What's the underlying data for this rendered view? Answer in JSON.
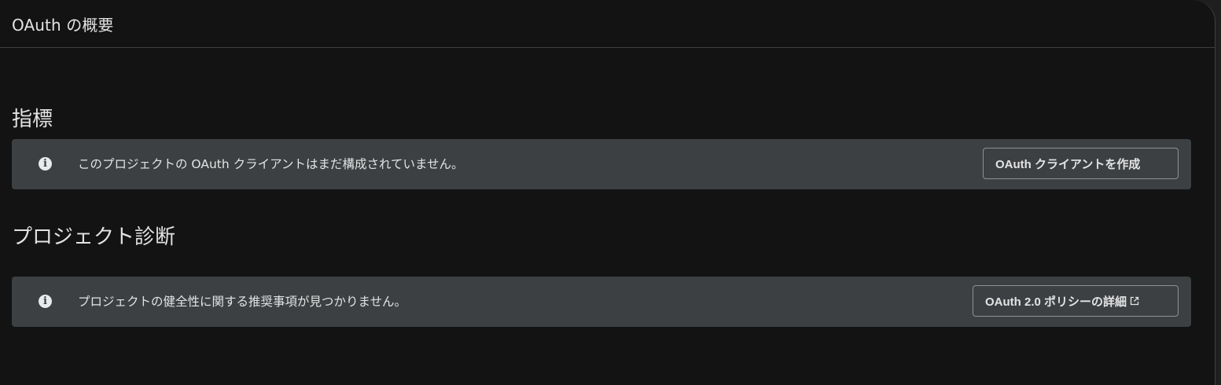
{
  "header": {
    "title": "OAuth の概要"
  },
  "metrics": {
    "title": "指標",
    "banner": {
      "icon": "info-icon",
      "message": "このプロジェクトの OAuth クライアントはまだ構成されていません。",
      "button_label": "OAuth クライアントを作成"
    }
  },
  "diagnostics": {
    "title": "プロジェクト診断",
    "banner": {
      "icon": "info-icon",
      "message": "プロジェクトの健全性に関する推奨事項が見つかりません。",
      "button_label": "OAuth 2.0 ポリシーの詳細",
      "button_icon": "external-link-icon"
    }
  },
  "colors": {
    "background": "#131314",
    "banner": "#3c4043",
    "text": "#e3e3e3",
    "border": "#8e918f"
  }
}
